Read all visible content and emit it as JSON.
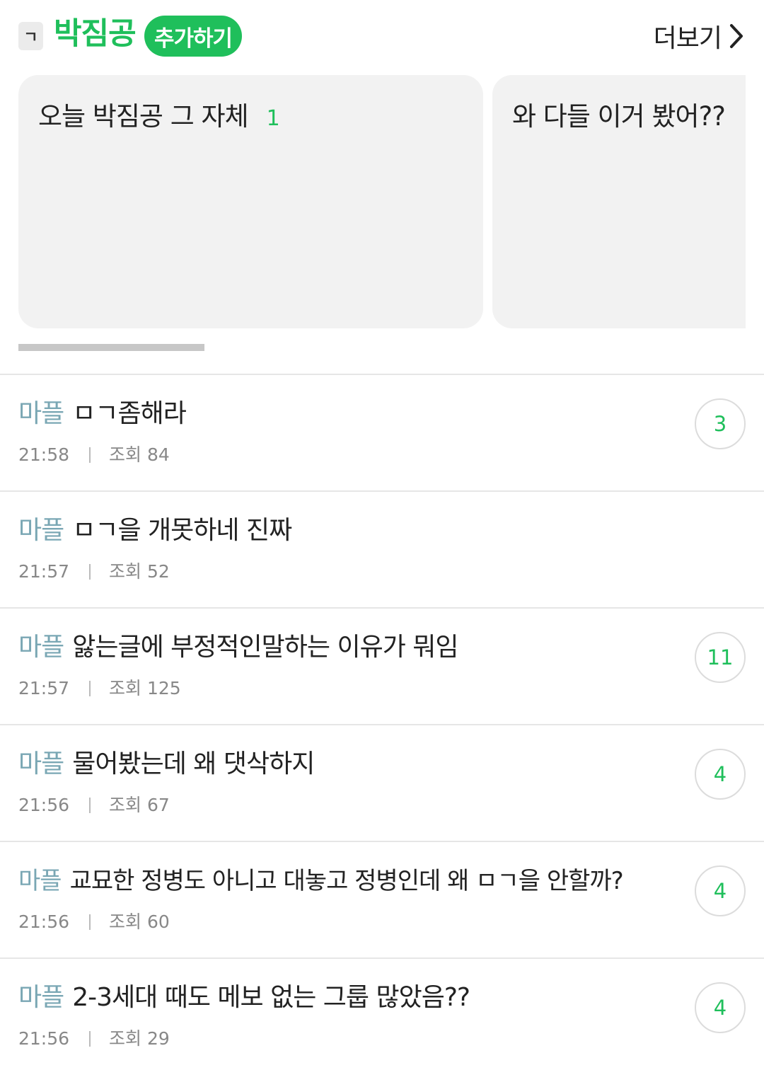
{
  "header": {
    "category_glyph": "ㄱ",
    "board_title": "박짐공",
    "add_label": "추가하기",
    "more_label": "더보기"
  },
  "featured": [
    {
      "title": "오늘 박짐공 그 자체",
      "count": "1"
    },
    {
      "title": "와 다들 이거 봤어??"
    }
  ],
  "posts": [
    {
      "tag": "마플",
      "title": "ㅁㄱ좀해라",
      "time": "21:58",
      "views": "조회 84",
      "replies": "3"
    },
    {
      "tag": "마플",
      "title": "ㅁㄱ을 개못하네 진짜",
      "time": "21:57",
      "views": "조회 52"
    },
    {
      "tag": "마플",
      "title": "앓는글에 부정적인말하는 이유가 뭐임",
      "time": "21:57",
      "views": "조회 125",
      "replies": "11"
    },
    {
      "tag": "마플",
      "title": "물어봤는데 왜 댓삭하지",
      "time": "21:56",
      "views": "조회 67",
      "replies": "4"
    },
    {
      "tag": "마플",
      "title": "교묘한 정병도 아니고 대놓고 정병인데 왜 ㅁㄱ을 안할까?",
      "time": "21:56",
      "views": "조회 60",
      "replies": "4"
    },
    {
      "tag": "마플",
      "title": "2-3세대 때도 메보 없는 그룹 많았음??",
      "time": "21:56",
      "views": "조회 29",
      "replies": "4"
    }
  ],
  "colors": {
    "accent": "#1fbf5b",
    "tag": "#7aa7b4",
    "meta": "#888888"
  }
}
